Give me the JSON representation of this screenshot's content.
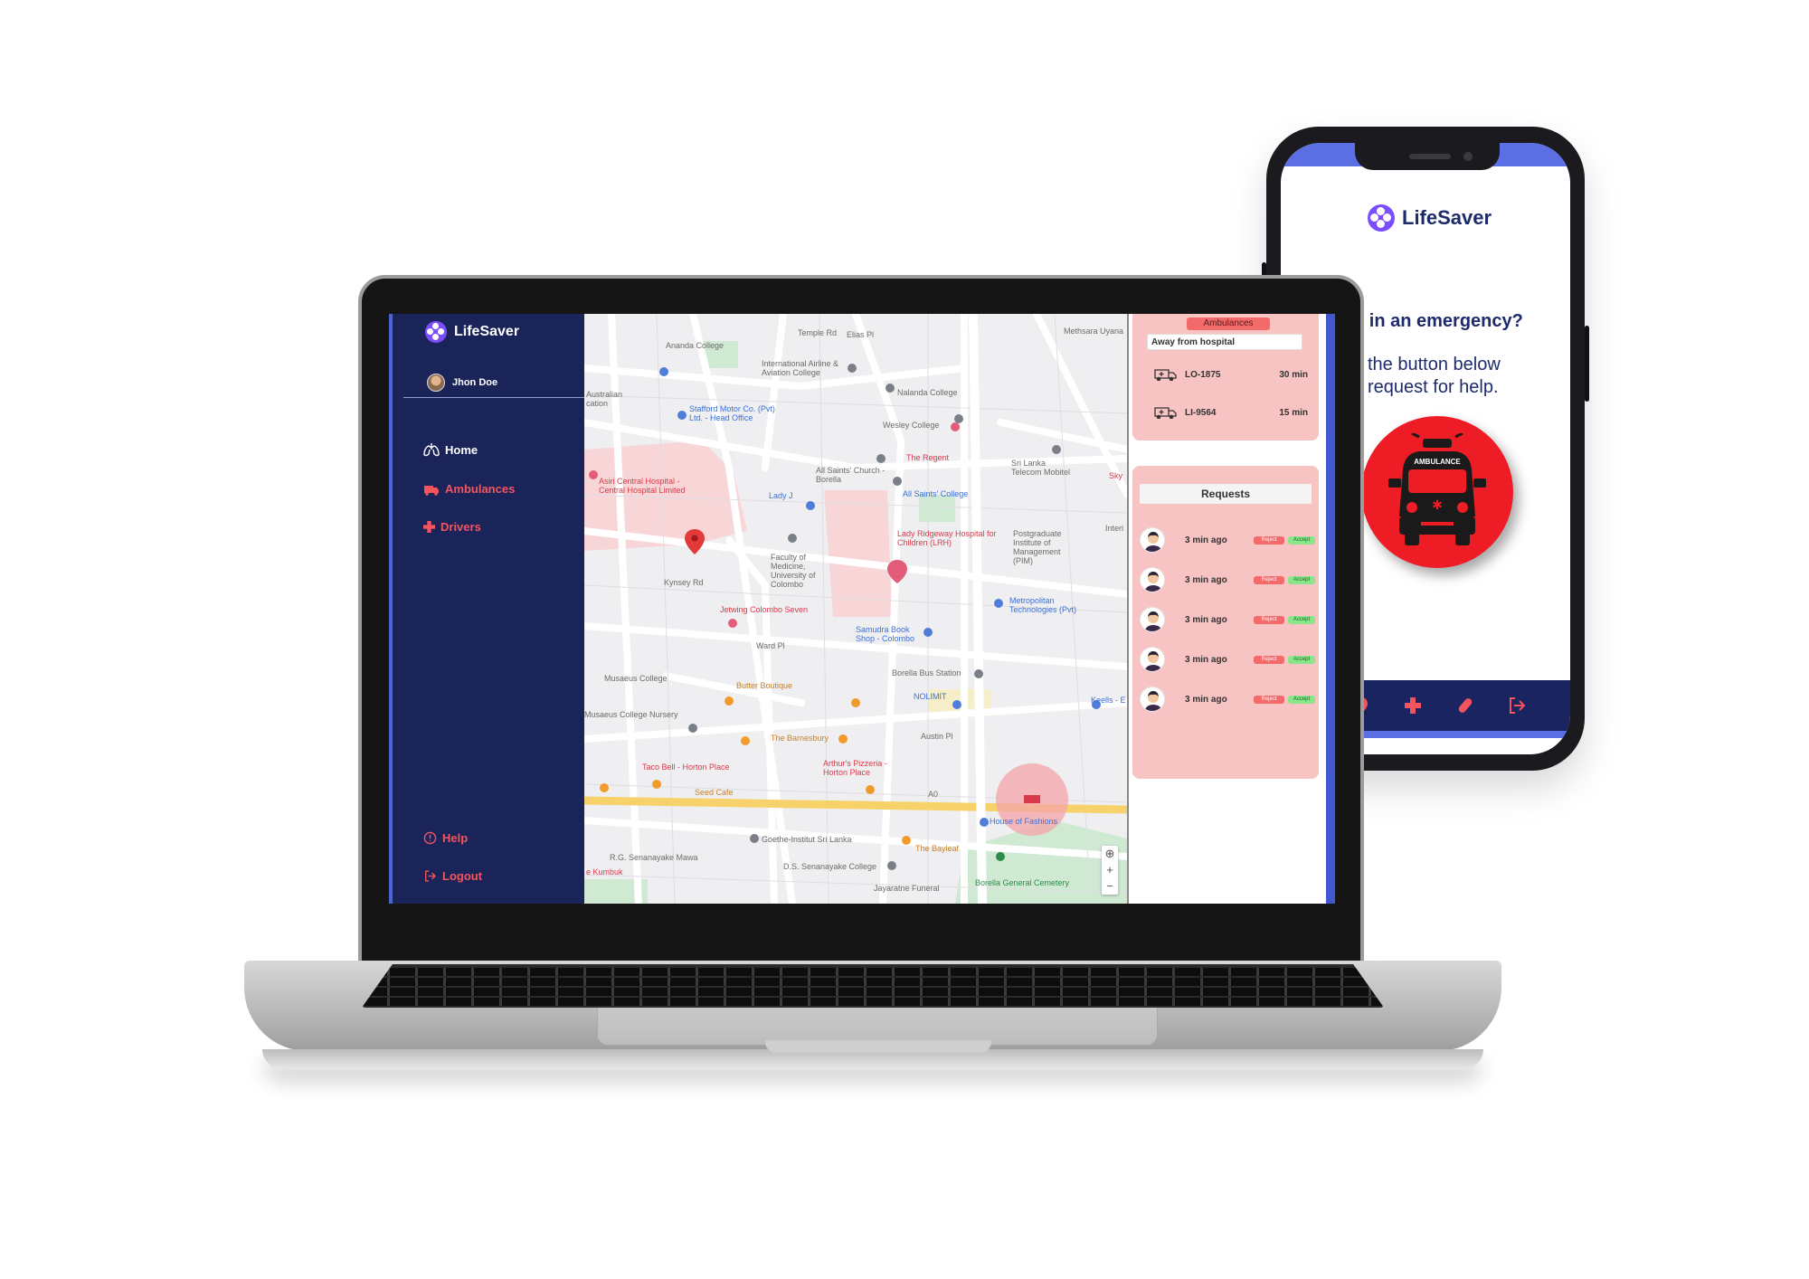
{
  "colors": {
    "navy": "#1a2459",
    "accent": "#4b63d6",
    "red": "#f4545e",
    "pink_card": "#f7c3c3",
    "sos_red": "#ee1c25",
    "logo_purple": "#7c4dff"
  },
  "phone": {
    "brand": "LifeSaver",
    "question": "u in an emergency?",
    "instruction_line1": "the button below",
    "instruction_line2": "request for help.",
    "sos_label": "AMBULANCE",
    "nav_icons": [
      "location-icon",
      "cross-icon",
      "pill-icon",
      "logout-icon"
    ]
  },
  "dashboard": {
    "brand": "LifeSaver",
    "user": {
      "name": "Jhon Doe"
    },
    "sidebar": {
      "items": [
        {
          "label": "Home",
          "icon": "lungs-icon"
        },
        {
          "label": "Ambulances",
          "icon": "ambulance-icon"
        },
        {
          "label": "Drivers",
          "icon": "cross-icon"
        }
      ],
      "help_label": "Help",
      "logout_label": "Logout"
    },
    "map": {
      "labels": [
        "Ananda College",
        "Temple Rd",
        "Elias Pl",
        "Methsara Uyana",
        "International Airline & Aviation College",
        "Australian cation",
        "Stafford Motor Co. (Pvt) Ltd. - Head Office",
        "Nalanda College",
        "Wesley College",
        "The Regent",
        "Sri Lanka Telecom Mobitel",
        "Asiri Central Hospital - Central Hospital Limited",
        "All Saints' Church - Borella",
        "Lady J",
        "All Saints' College",
        "Postgraduate Institute of Management (PIM)",
        "Faculty of Medicine, University of Colombo",
        "Lady Ridgeway Hospital for Children (LRH)",
        "Kynsey Rd",
        "Jetwing Colombo Seven",
        "Metropolitan Technologies (Pvt)",
        "Samudra Book Shop - Colombo",
        "Ward Pl",
        "Borella Bus Station",
        "Musaeus College",
        "Butter Boutique",
        "NOLIMIT",
        "Keells - E",
        "Musaeus College Nursery",
        "The Barnesbury",
        "Austin Pl",
        "Taco Bell - Horton Place",
        "Arthur's Pizzeria - Horton Place",
        "Seed Cafe",
        "A0",
        "House of Fashions",
        "Goethe-Institut Sri Lanka",
        "The Bayleaf",
        "R.G. Senanayake Mawa",
        "D.S. Senanayake College",
        "Borella General Cemetery",
        "Jayaratne Funeral",
        "e Kumbuk",
        "Interi",
        "Sky"
      ]
    },
    "ambulances": {
      "title": "Ambulances",
      "filter_label": "Away from hospital",
      "rows": [
        {
          "id": "LO-1875",
          "eta": "30 min"
        },
        {
          "id": "LI-9564",
          "eta": "15 min"
        }
      ]
    },
    "requests": {
      "title": "Requests",
      "reject_label": "Reject",
      "accept_label": "Accept",
      "rows": [
        {
          "time": "3 min ago"
        },
        {
          "time": "3 min ago"
        },
        {
          "time": "3 min ago"
        },
        {
          "time": "3 min ago"
        },
        {
          "time": "3 min ago"
        }
      ]
    }
  }
}
